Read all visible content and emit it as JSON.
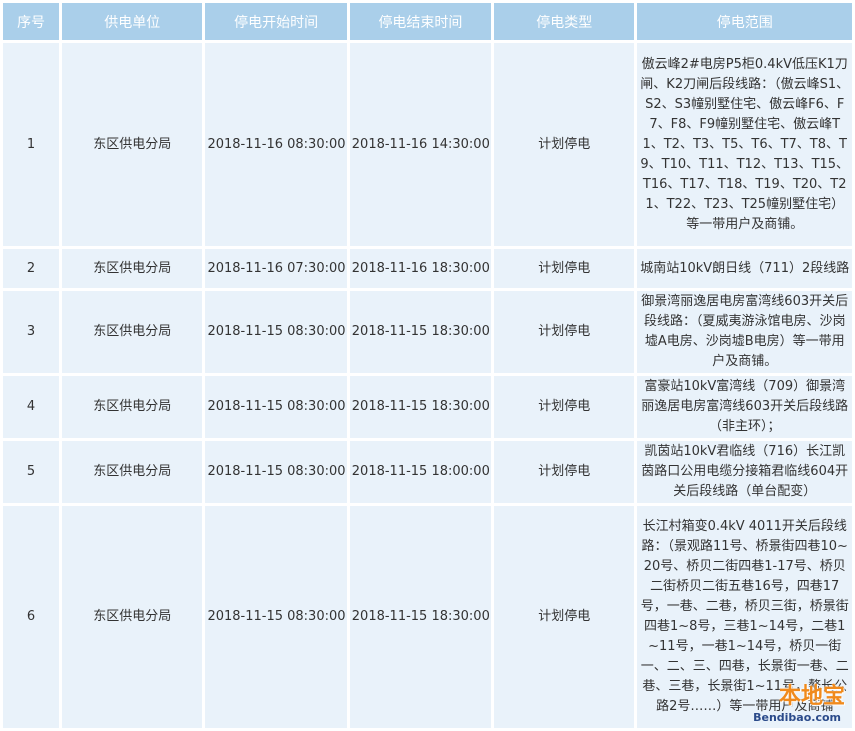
{
  "table": {
    "headers": [
      "序号",
      "供电单位",
      "停电开始时间",
      "停电结束时间",
      "停电类型",
      "停电范围"
    ],
    "rows": [
      {
        "no": "1",
        "unit": "东区供电分局",
        "start": "2018-11-16 08:30:00",
        "end": "2018-11-16 14:30:00",
        "type": "计划停电",
        "scope": "傲云峰2#电房P5柜0.4kV低压K1刀闸、K2刀闸后段线路：（傲云峰S1、S2、S3幢别墅住宅、傲云峰F6、F7、F8、F9幢别墅住宅、傲云峰T1、T2、T3、T5、T6、T7、T8、T9、T10、T11、T12、T13、T15、T16、T17、T18、T19、T20、T21、T22、T23、T25幢别墅住宅）等一带用户及商铺。"
      },
      {
        "no": "2",
        "unit": "东区供电分局",
        "start": "2018-11-16 07:30:00",
        "end": "2018-11-16 18:30:00",
        "type": "计划停电",
        "scope": "城南站10kV朗日线（711）2段线路"
      },
      {
        "no": "3",
        "unit": "东区供电分局",
        "start": "2018-11-15 08:30:00",
        "end": "2018-11-15 18:30:00",
        "type": "计划停电",
        "scope": "御景湾丽逸居电房富湾线603开关后段线路：（夏威夷游泳馆电房、沙岗墟A电房、沙岗墟B电房）等一带用户及商铺。"
      },
      {
        "no": "4",
        "unit": "东区供电分局",
        "start": "2018-11-15 08:30:00",
        "end": "2018-11-15 18:30:00",
        "type": "计划停电",
        "scope": "富豪站10kV富湾线（709）御景湾丽逸居电房富湾线603开关后段线路（非主环）；"
      },
      {
        "no": "5",
        "unit": "东区供电分局",
        "start": "2018-11-15 08:30:00",
        "end": "2018-11-15 18:00:00",
        "type": "计划停电",
        "scope": "凯茵站10kV君临线（716）长江凯茵路口公用电缆分接箱君临线604开关后段线路（单台配变）"
      },
      {
        "no": "6",
        "unit": "东区供电分局",
        "start": "2018-11-15 08:30:00",
        "end": "2018-11-15 18:30:00",
        "type": "计划停电",
        "scope": "长江村箱变0.4kV 4011开关后段线路：（景观路11号、桥景街四巷10~20号、桥贝二街四巷1-17号、桥贝二街桥贝二街五巷16号，四巷17号，一巷、二巷，桥贝三街，桥景街四巷1~8号，三巷1~14号，二巷1~11号，一巷1~14号，桥贝一街一、二、三、四巷，长景街一巷、二巷、三巷，长景街1~11号，鳌长公路2号……）等一带用户及商铺"
      }
    ]
  },
  "watermark": {
    "logo": "本地宝",
    "site": "Bendibao.com"
  }
}
